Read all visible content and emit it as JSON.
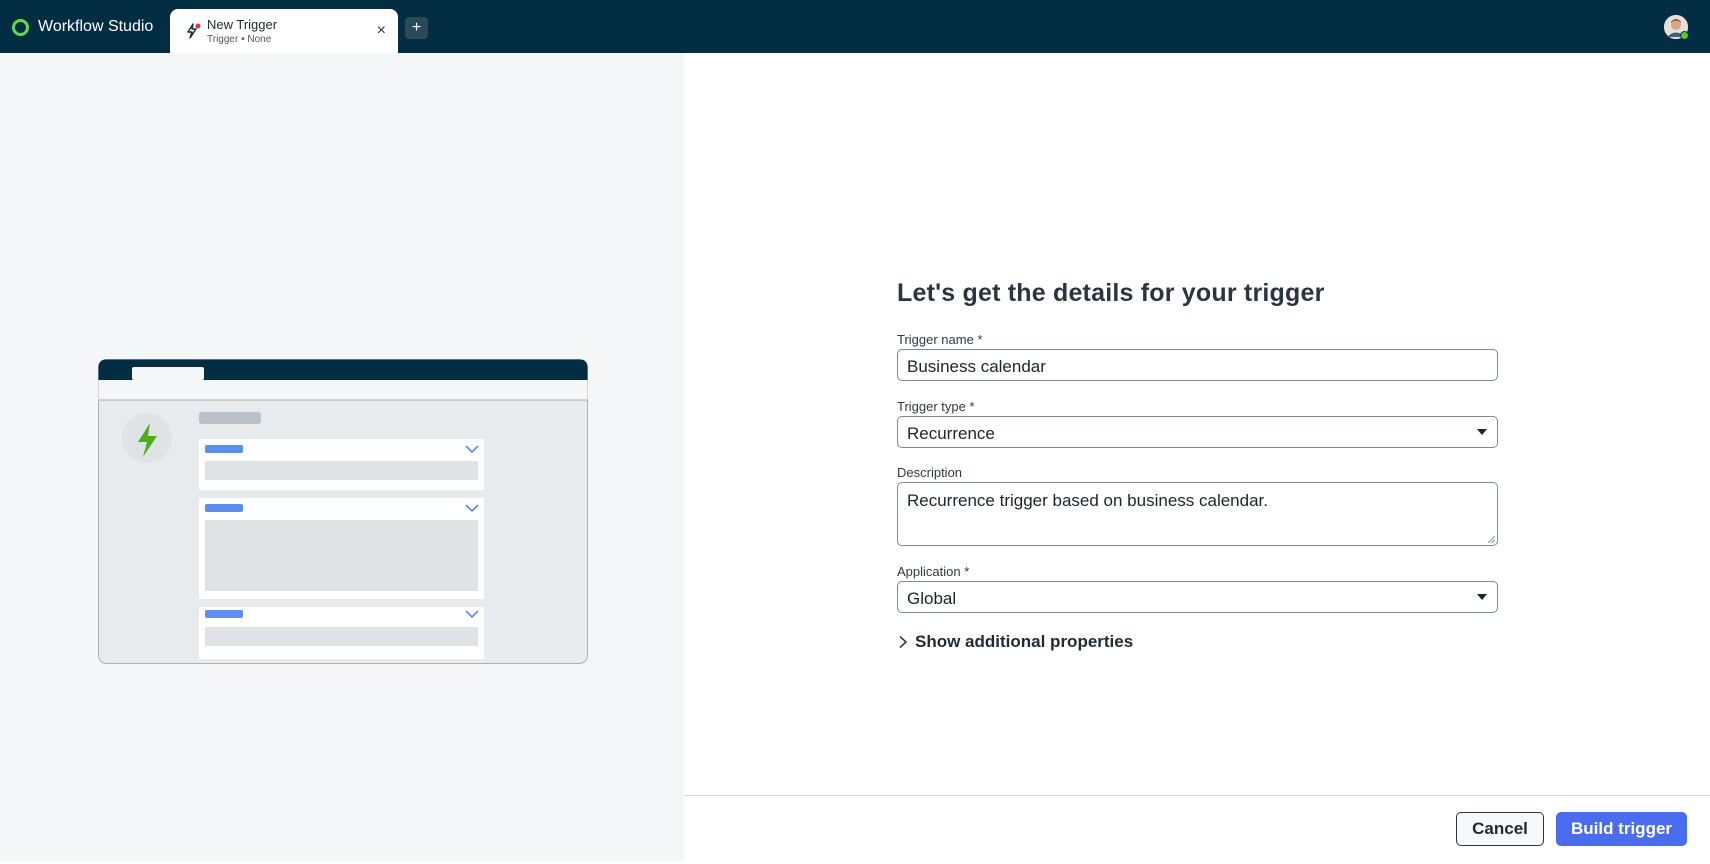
{
  "app": {
    "title": "Workflow Studio"
  },
  "tab": {
    "title": "New Trigger",
    "subtitle": "Trigger • None",
    "close": "×",
    "new_tab": "+"
  },
  "form": {
    "heading": "Let's get the details for your trigger",
    "trigger_name": {
      "label": "Trigger name *",
      "value": "Business calendar"
    },
    "trigger_type": {
      "label": "Trigger type *",
      "value": "Recurrence"
    },
    "description": {
      "label": "Description",
      "value": "Recurrence trigger based on business calendar."
    },
    "application": {
      "label": "Application *",
      "value": "Global"
    },
    "show_more": "Show additional properties"
  },
  "footer": {
    "cancel_label": "Cancel",
    "build_label": "Build trigger"
  },
  "colors": {
    "topbar": "#032d42",
    "accent": "#4a6cf0",
    "brand_green": "#62d84e",
    "bolt_green": "#4dad1f"
  },
  "icons": {
    "brand": "workflow-logo-icon",
    "tab": "trigger-icon",
    "chevron": "chevron-right-icon",
    "bolt": "lightning-bolt-icon"
  }
}
